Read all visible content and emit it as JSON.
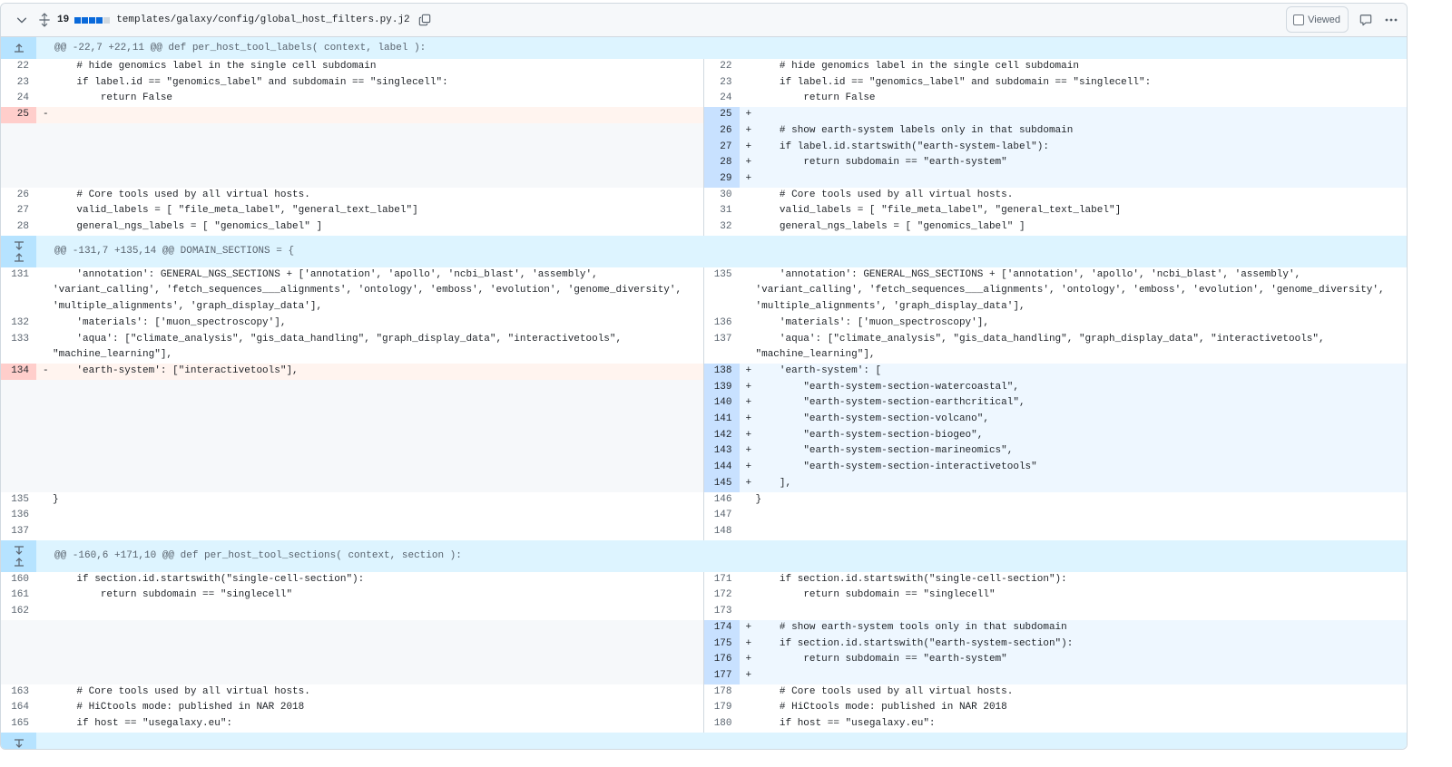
{
  "file_header": {
    "changes_count": "19",
    "file_path": "templates/galaxy/config/global_host_filters.py.j2",
    "viewed_label": "Viewed",
    "icons": [
      "chevron-down-icon",
      "move-icon",
      "copy-icon",
      "comment-icon",
      "kebab-icon"
    ]
  },
  "colors": {
    "hunk_bg": "#ddf4ff",
    "add_line_bg": "#eef7ff",
    "add_num_bg": "#c8e1ff",
    "del_line_bg": "#fff4ef",
    "del_num_bg": "#ffcecb"
  },
  "hunks": [
    {
      "header": "@@ -22,7 +22,11 @@ def per_host_tool_labels( context, label ):",
      "expander": "up",
      "rows": [
        {
          "type": "ctx",
          "ln": "22",
          "rn": "22",
          "code": "    # hide genomics label in the single cell subdomain"
        },
        {
          "type": "ctx",
          "ln": "23",
          "rn": "23",
          "code": "    if label.id == \"genomics_label\" and subdomain == \"singlecell\":"
        },
        {
          "type": "ctx",
          "ln": "24",
          "rn": "24",
          "code": "        return False"
        },
        {
          "type": "chg",
          "ln": "25",
          "lcode": "",
          "rn": "25",
          "rcode": ""
        },
        {
          "type": "add",
          "rn": "26",
          "rcode": "    # show earth-system labels only in that subdomain"
        },
        {
          "type": "add",
          "rn": "27",
          "rcode": "    if label.id.startswith(\"earth-system-label\"):"
        },
        {
          "type": "add",
          "rn": "28",
          "rcode": "        return subdomain == \"earth-system\""
        },
        {
          "type": "add",
          "rn": "29",
          "rcode": ""
        },
        {
          "type": "ctx",
          "ln": "26",
          "rn": "30",
          "code": "    # Core tools used by all virtual hosts."
        },
        {
          "type": "ctx",
          "ln": "27",
          "rn": "31",
          "code": "    valid_labels = [ \"file_meta_label\", \"general_text_label\"]"
        },
        {
          "type": "ctx",
          "ln": "28",
          "rn": "32",
          "code": "    general_ngs_labels = [ \"genomics_label\" ]"
        }
      ]
    },
    {
      "header": "@@ -131,7 +135,14 @@ DOMAIN_SECTIONS = {",
      "expander": "both",
      "rows": [
        {
          "type": "ctx",
          "ln": "131",
          "rn": "135",
          "code": "    'annotation': GENERAL_NGS_SECTIONS + ['annotation', 'apollo', 'ncbi_blast', 'assembly', 'variant_calling', 'fetch_sequences___alignments', 'ontology', 'emboss', 'evolution', 'genome_diversity', 'multiple_alignments', 'graph_display_data'],"
        },
        {
          "type": "ctx",
          "ln": "132",
          "rn": "136",
          "code": "    'materials': ['muon_spectroscopy'],"
        },
        {
          "type": "ctx",
          "ln": "133",
          "rn": "137",
          "code": "    'aqua': [\"climate_analysis\", \"gis_data_handling\", \"graph_display_data\", \"interactivetools\", \"machine_learning\"],"
        },
        {
          "type": "chg",
          "ln": "134",
          "lcode": "    'earth-system': [\"interactivetools\"],",
          "rn": "138",
          "rcode": "    'earth-system': ["
        },
        {
          "type": "add",
          "rn": "139",
          "rcode": "        \"earth-system-section-watercoastal\","
        },
        {
          "type": "add",
          "rn": "140",
          "rcode": "        \"earth-system-section-earthcritical\","
        },
        {
          "type": "add",
          "rn": "141",
          "rcode": "        \"earth-system-section-volcano\","
        },
        {
          "type": "add",
          "rn": "142",
          "rcode": "        \"earth-system-section-biogeo\","
        },
        {
          "type": "add",
          "rn": "143",
          "rcode": "        \"earth-system-section-marineomics\","
        },
        {
          "type": "add",
          "rn": "144",
          "rcode": "        \"earth-system-section-interactivetools\""
        },
        {
          "type": "add",
          "rn": "145",
          "rcode": "    ],"
        },
        {
          "type": "ctx",
          "ln": "135",
          "rn": "146",
          "code": "}"
        },
        {
          "type": "ctx",
          "ln": "136",
          "rn": "147",
          "code": ""
        },
        {
          "type": "ctx",
          "ln": "137",
          "rn": "148",
          "code": ""
        }
      ]
    },
    {
      "header": "@@ -160,6 +171,10 @@ def per_host_tool_sections( context, section ):",
      "expander": "both",
      "rows": [
        {
          "type": "ctx",
          "ln": "160",
          "rn": "171",
          "code": "    if section.id.startswith(\"single-cell-section\"):"
        },
        {
          "type": "ctx",
          "ln": "161",
          "rn": "172",
          "code": "        return subdomain == \"singlecell\""
        },
        {
          "type": "ctx",
          "ln": "162",
          "rn": "173",
          "code": ""
        },
        {
          "type": "add",
          "rn": "174",
          "rcode": "    # show earth-system tools only in that subdomain"
        },
        {
          "type": "add",
          "rn": "175",
          "rcode": "    if section.id.startswith(\"earth-system-section\"):"
        },
        {
          "type": "add",
          "rn": "176",
          "rcode": "        return subdomain == \"earth-system\""
        },
        {
          "type": "add",
          "rn": "177",
          "rcode": ""
        },
        {
          "type": "ctx",
          "ln": "163",
          "rn": "178",
          "code": "    # Core tools used by all virtual hosts."
        },
        {
          "type": "ctx",
          "ln": "164",
          "rn": "179",
          "code": "    # HiCtools mode: published in NAR 2018"
        },
        {
          "type": "ctx",
          "ln": "165",
          "rn": "180",
          "code": "    if host == \"usegalaxy.eu\":"
        }
      ]
    },
    {
      "header": "",
      "expander": "down",
      "rows": []
    }
  ]
}
